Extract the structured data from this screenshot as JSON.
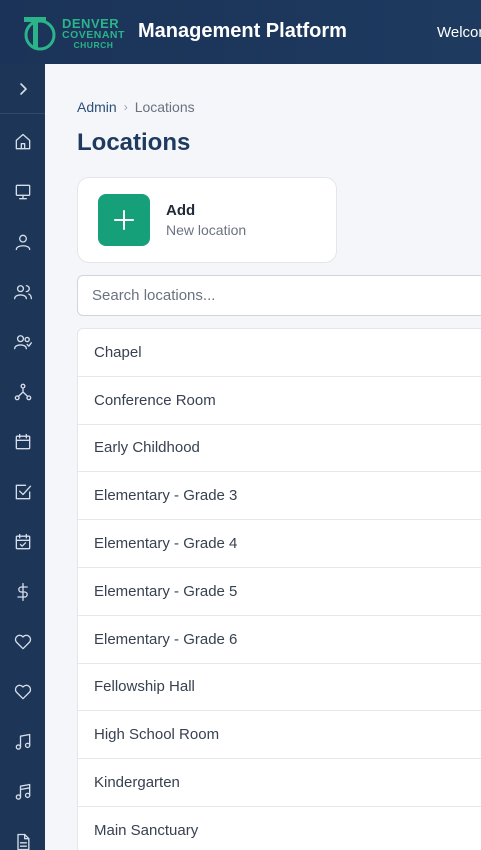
{
  "header": {
    "logo_line1": "DENVER",
    "logo_line2": "COVENANT",
    "logo_line3": "CHURCH",
    "title": "Management Platform",
    "welcome": "Welcome"
  },
  "sidebar": {
    "toggle_icon": "chevron-right-icon",
    "items": [
      {
        "icon": "home-icon"
      },
      {
        "icon": "monitor-icon"
      },
      {
        "icon": "user-icon"
      },
      {
        "icon": "users-icon"
      },
      {
        "icon": "user-group-icon"
      },
      {
        "icon": "network-icon"
      },
      {
        "icon": "calendar-icon"
      },
      {
        "icon": "checkbox-icon"
      },
      {
        "icon": "calendar-check-icon"
      },
      {
        "icon": "dollar-icon"
      },
      {
        "icon": "heart-icon"
      },
      {
        "icon": "heart-outline-icon"
      },
      {
        "icon": "music-icon"
      },
      {
        "icon": "music-notes-icon"
      },
      {
        "icon": "document-icon"
      }
    ]
  },
  "breadcrumb": {
    "root": "Admin",
    "separator": "›",
    "current": "Locations"
  },
  "page": {
    "title": "Locations"
  },
  "add_card": {
    "title": "Add",
    "subtitle": "New location",
    "icon": "plus-icon"
  },
  "search": {
    "placeholder": "Search locations..."
  },
  "locations": [
    "Chapel",
    "Conference Room",
    "Early Childhood",
    "Elementary - Grade 3",
    "Elementary - Grade 4",
    "Elementary - Grade 5",
    "Elementary - Grade 6",
    "Fellowship Hall",
    "High School Room",
    "Kindergarten",
    "Main Sanctuary"
  ],
  "colors": {
    "header_bg": "#1e3a5f",
    "sidebar_bg": "#1d3557",
    "accent_green": "#16a07a",
    "logo_green": "#2bb38a",
    "title_blue": "#1e3a5f"
  }
}
